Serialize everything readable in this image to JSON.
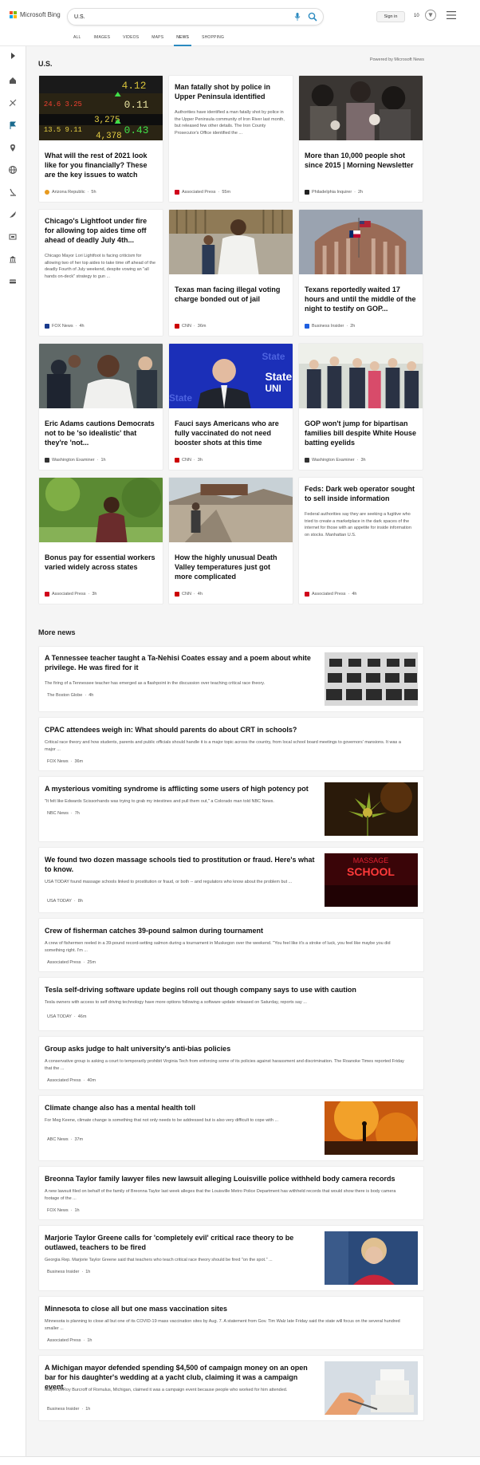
{
  "brand": {
    "name": "Microsoft Bing"
  },
  "search": {
    "query": "U.S."
  },
  "account": {
    "signin_label": "Sign in",
    "points": "10"
  },
  "tabs": [
    {
      "label": "ALL"
    },
    {
      "label": "IMAGES"
    },
    {
      "label": "VIDEOS"
    },
    {
      "label": "MAPS"
    },
    {
      "label": "NEWS"
    },
    {
      "label": "SHOPPING"
    }
  ],
  "active_tab": "NEWS",
  "section": {
    "title": "U.S.",
    "powered_by": "Powered by Microsoft News"
  },
  "cards": [
    {
      "title": "What will the rest of 2021 look like for you financially? These are the key issues to watch",
      "source": "Arizona Republic",
      "time": "5h",
      "source_color": "#e79a1f"
    },
    {
      "title": "Man fatally shot by police in Upper Peninsula identified",
      "desc": "Authorities have identified a man fatally shot by police in the Upper Peninsula community of Iron River last month, but released few other details. The Iron County Prosecutor's Office identified the ...",
      "source": "Associated Press",
      "time": "55m",
      "source_color": "#d0021b"
    },
    {
      "title": "More than 10,000 people shot since 2015 | Morning Newsletter",
      "source": "Philadelphia Inquirer",
      "time": "2h",
      "source_color": "#222222"
    },
    {
      "title": "Chicago's Lightfoot under fire for allowing top aides time off ahead of deadly July 4th...",
      "desc": "Chicago Mayor Lori Lightfoot is facing criticism for allowing two of her top aides to take time off ahead of the deadly Fourth of July weekend, despite vowing an \"all hands on-deck\" strategy to gun ...",
      "source": "FOX News",
      "time": "4h",
      "source_color": "#1a3b8c"
    },
    {
      "title": "Texas man facing illegal voting charge bonded out of jail",
      "source": "CNN",
      "time": "36m",
      "source_color": "#cc0000"
    },
    {
      "title": "Texans reportedly waited 17 hours and until the middle of the night to testify on GOP...",
      "source": "Business Insider",
      "time": "2h",
      "source_color": "#1f5fe0"
    },
    {
      "title": "Eric Adams cautions Democrats not to be 'so idealistic' that they're 'not...",
      "source": "Washington Examiner",
      "time": "1h",
      "source_color": "#333333"
    },
    {
      "title": "Fauci says Americans who are fully vaccinated do not need booster shots at this time",
      "source": "CNN",
      "time": "3h",
      "source_color": "#cc0000"
    },
    {
      "title": "GOP won't jump for bipartisan families bill despite White House batting eyelids",
      "source": "Washington Examiner",
      "time": "3h",
      "source_color": "#333333"
    },
    {
      "title": "Bonus pay for essential workers varied widely across states",
      "source": "Associated Press",
      "time": "3h",
      "source_color": "#d0021b"
    },
    {
      "title": "How the highly unusual Death Valley temperatures just got more complicated",
      "source": "CNN",
      "time": "4h",
      "source_color": "#cc0000"
    },
    {
      "title": "Feds: Dark web operator sought to sell inside information",
      "desc": "Federal authorities say they are seeking a fugitive who tried to create a marketplace in the dark spaces of the internet for those with an appetite for inside information on stocks. Manhattan U.S.",
      "source": "Associated Press",
      "time": "4h",
      "source_color": "#d0021b"
    }
  ],
  "more_news": {
    "title": "More news",
    "items": [
      {
        "title": "A Tennessee teacher taught a Ta-Nehisi Coates essay and a poem about white privilege. He was fired for it",
        "desc": "The firing of a Tennessee teacher has emerged as a flashpoint in the discussion over teaching critical race theory.",
        "source": "The Boston Globe",
        "time": "4h",
        "source_color": "#222222"
      },
      {
        "title": "CPAC attendees weigh in: What should parents do about CRT in schools?",
        "desc": "Critical race theory and how students, parents and public officials should handle it is a major topic across the country, from local school board meetings to governors' mansions. It was a major ...",
        "source": "FOX News",
        "time": "36m",
        "source_color": "#1a3b8c"
      },
      {
        "title": "A mysterious vomiting syndrome is afflicting some users of high potency pot",
        "desc": "\"It felt like Edwards Scissorhands was trying to grab my intestines and pull them out,\" a Colorado man told NBC News.",
        "source": "NBC News",
        "time": "7h",
        "source_color": "#444444"
      },
      {
        "title": "We found two dozen massage schools tied to prostitution or fraud. Here's what to know.",
        "desc": "USA TODAY found massage schools linked to prostitution or fraud, or both -- and regulators who know about the problem but ...",
        "source": "USA TODAY",
        "time": "8h",
        "source_color": "#1e88e5"
      },
      {
        "title": "Crew of fisherman catches 39-pound salmon during tournament",
        "desc": "A crew of fishermen reeled in a 39-pound record-setting salmon during a tournament in Muskegon over the weekend. \"You feel like it's a stroke of luck, you feel like maybe you did something right. I'm ...",
        "source": "Associated Press",
        "time": "25m",
        "source_color": "#d0021b"
      },
      {
        "title": "Tesla self-driving software update begins roll out though company says to use with caution",
        "desc": "Tesla owners with access to self driving technology have more options following a software update released on Saturday, reports say ...",
        "source": "USA TODAY",
        "time": "46m",
        "source_color": "#1e88e5"
      },
      {
        "title": "Group asks judge to halt university's anti-bias policies",
        "desc": "A conservative group is asking a court to temporarily prohibit Virginia Tech from enforcing some of its policies against harassment and discrimination. The Roanoke Times reported Friday that the ...",
        "source": "Associated Press",
        "time": "40m",
        "source_color": "#d0021b"
      },
      {
        "title": "Climate change also has a mental health toll",
        "desc": "For Meg Keene, climate change is something that not only needs to be addressed but is also very difficult to cope with ...",
        "source": "ABC News",
        "time": "37m",
        "source_color": "#222222"
      },
      {
        "title": "Breonna Taylor family lawyer files new lawsuit alleging Louisville police withheld body camera records",
        "desc": "A new lawsuit filed on behalf of the family of Breonna Taylor last week alleges that the Louisville Metro Police Department has withheld records that would show there is body camera footage of the ...",
        "source": "FOX News",
        "time": "1h",
        "source_color": "#1a3b8c"
      },
      {
        "title": "Marjorie Taylor Greene calls for 'completely evil' critical race theory to be outlawed, teachers to be fired",
        "desc": "Georgia Rep. Marjorie Taylor Greene said that teachers who teach critical race theory should be fired \"on the spot.\" ...",
        "source": "Business Insider",
        "time": "1h",
        "source_color": "#1f5fe0"
      },
      {
        "title": "Minnesota to close all but one mass vaccination sites",
        "desc": "Minnesota is planning to close all but one of its COVID-19 mass vaccination sites by Aug. 7. A statement from Gov. Tim Walz late Friday said the state will focus on the several hundred smaller ...",
        "source": "Associated Press",
        "time": "1h",
        "source_color": "#d0021b"
      },
      {
        "title": "A Michigan mayor defended spending $4,500 of campaign money on an open bar for his daughter's wedding at a yacht club, claiming it was a campaign event",
        "desc": "Mayor LeRoy Burcroff of Romulus, Michigan, claimed it was a campaign event because people who worked for him attended.",
        "source": "Business Insider",
        "time": "1h",
        "source_color": "#1f5fe0"
      }
    ]
  },
  "thumb_text": {
    "massage": "MASSAGE SCHOOL",
    "fauci_bg": "State UNI"
  }
}
